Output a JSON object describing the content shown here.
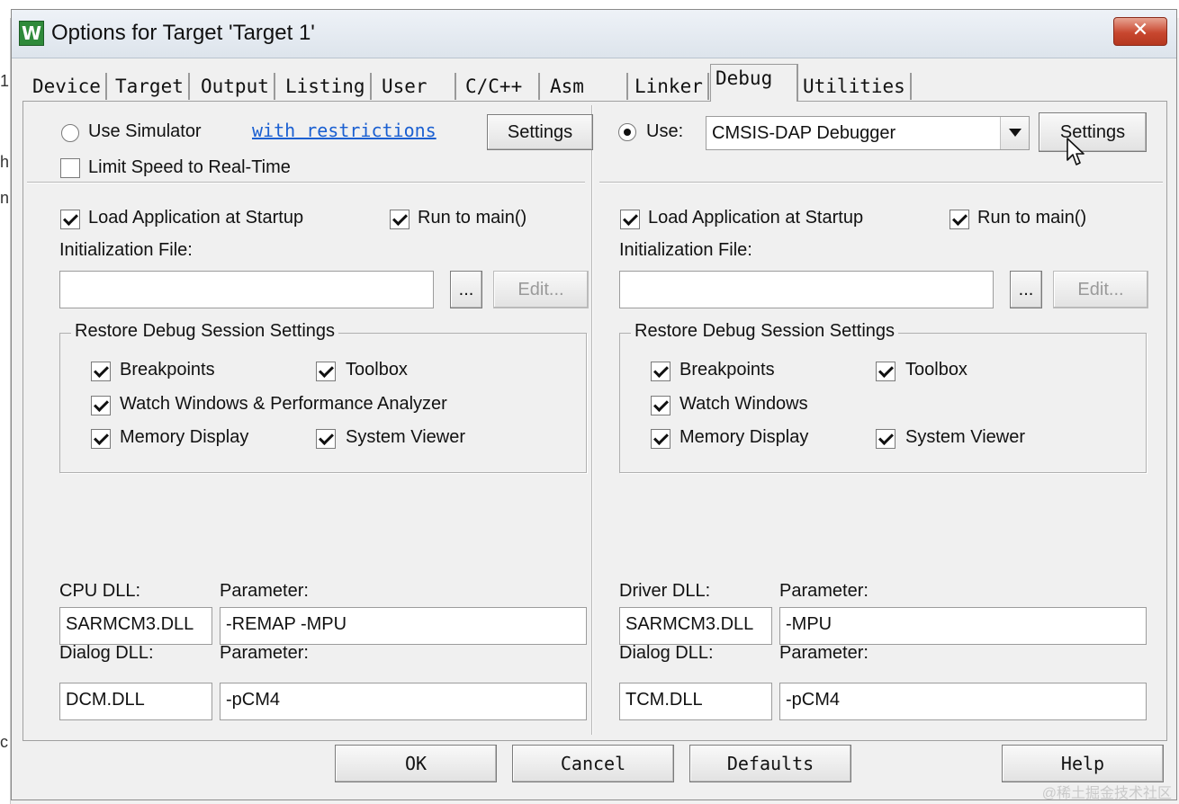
{
  "background": {
    "edge_glyphs": [
      "1",
      "h",
      "n",
      "c"
    ]
  },
  "window": {
    "title": "Options for Target 'Target 1'",
    "icon_letter": "W",
    "close_glyph": "✕"
  },
  "tabs": [
    "Device",
    "Target",
    "Output",
    "Listing",
    "User",
    "C/C++",
    "Asm",
    "Linker",
    "Debug",
    "Utilities"
  ],
  "left": {
    "use_simulator": "Use Simulator",
    "restrictions_link": "with restrictions",
    "settings_label": "Settings",
    "limit_speed": "Limit Speed to Real-Time",
    "load_app": "Load Application at Startup",
    "run_to_main": "Run to main()",
    "init_file_label": "Initialization File:",
    "init_file_value": "",
    "browse_label": "...",
    "edit_label": "Edit...",
    "restore_title": "Restore Debug Session Settings",
    "breakpoints": "Breakpoints",
    "toolbox": "Toolbox",
    "watch": "Watch Windows & Performance Analyzer",
    "memory": "Memory Display",
    "system_viewer": "System Viewer",
    "cpu_dll_label": "CPU DLL:",
    "param_label_1": "Parameter:",
    "cpu_dll_value": "SARMCM3.DLL",
    "cpu_param_value": "-REMAP -MPU",
    "dialog_dll_label": "Dialog DLL:",
    "param_label_2": "Parameter:",
    "dialog_dll_value": "DCM.DLL",
    "dialog_param_value": "-pCM4"
  },
  "right": {
    "use_label": "Use:",
    "debugger": "CMSIS-DAP Debugger",
    "settings_label": "Settings",
    "load_app": "Load Application at Startup",
    "run_to_main": "Run to main()",
    "init_file_label": "Initialization File:",
    "init_file_value": "",
    "browse_label": "...",
    "edit_label": "Edit...",
    "restore_title": "Restore Debug Session Settings",
    "breakpoints": "Breakpoints",
    "toolbox": "Toolbox",
    "watch": "Watch Windows",
    "memory": "Memory Display",
    "system_viewer": "System Viewer",
    "driver_dll_label": "Driver DLL:",
    "param_label_1": "Parameter:",
    "driver_dll_value": "SARMCM3.DLL",
    "driver_param_value": "-MPU",
    "dialog_dll_label": "Dialog DLL:",
    "param_label_2": "Parameter:",
    "dialog_dll_value": "TCM.DLL",
    "dialog_param_value": "-pCM4"
  },
  "footer": {
    "ok": "OK",
    "cancel": "Cancel",
    "defaults": "Defaults",
    "help": "Help"
  },
  "watermark": "@稀土掘金技术社区",
  "colors": {
    "link": "#1a5fd1",
    "close_button": "#c8472f",
    "app_icon": "#2f8a3a"
  }
}
